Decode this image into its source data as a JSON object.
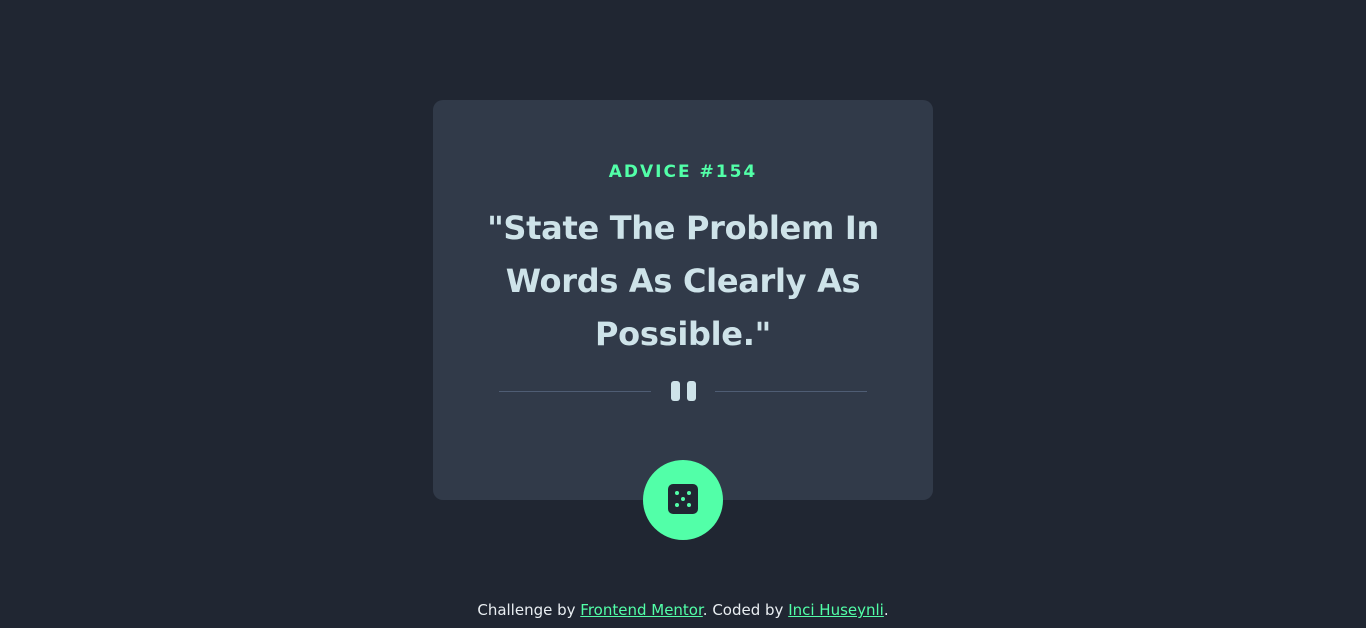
{
  "card": {
    "advice_label": "ADVICE #154",
    "advice_text": "\"State The Problem In Words As Clearly As Possible.\""
  },
  "actions": {
    "dice_icon": "dice-icon",
    "divider_icon": "pause-icon"
  },
  "footer": {
    "prefix": "Challenge by ",
    "challenge_link": "Frontend Mentor",
    "middle": ". Coded by ",
    "author_link": "Inci Huseynli",
    "suffix": "."
  },
  "colors": {
    "background": "#202632",
    "card": "#313a49",
    "accent": "#52ffa8",
    "text": "#cee3e9",
    "divider": "#4f5d74"
  }
}
